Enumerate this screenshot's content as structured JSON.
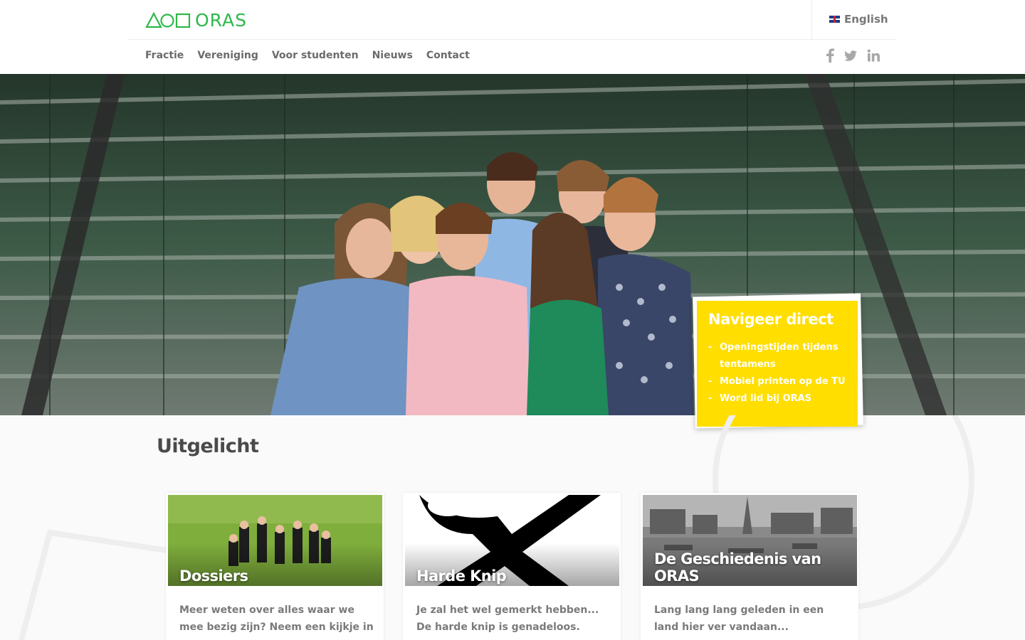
{
  "header": {
    "logo_text": "ORAS",
    "language": "English",
    "nav": [
      "Fractie",
      "Vereniging",
      "Voor studenten",
      "Nieuws",
      "Contact"
    ],
    "social": {
      "facebook": "f",
      "twitter": "🐦",
      "linkedin": "in"
    }
  },
  "hero": {
    "navigate_title": "Navigeer direct",
    "links": [
      "Openingstijden tijdens tentamens",
      "Mobiel printen op de TU",
      "Word lid bij ORAS"
    ]
  },
  "main": {
    "section_title": "Uitgelicht",
    "cards": [
      {
        "title": "Dossiers",
        "text": "Meer weten over alles waar we mee bezig zijn? Neem een kijkje in onze"
      },
      {
        "title": "Harde Knip",
        "text": "Je zal het wel gemerkt hebben... De harde knip is genadeloos."
      },
      {
        "title": "De Geschiedenis van ORAS",
        "text": "Lang lang lang geleden in een land hier ver vandaan..."
      }
    ]
  },
  "colors": {
    "brand_green": "#2db84a",
    "accent_yellow": "#ffde00"
  }
}
